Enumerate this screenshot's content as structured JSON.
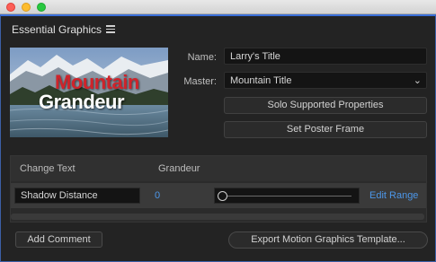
{
  "panel": {
    "title": "Essential Graphics",
    "menu_icon": "hamburger-menu-icon"
  },
  "preview": {
    "title_line1": "Mountain",
    "title_line2": "Grandeur"
  },
  "properties": {
    "name_label": "Name:",
    "name_value": "Larry's Title",
    "master_label": "Master:",
    "master_value": "Mountain Title",
    "solo_button": "Solo Supported Properties",
    "poster_button": "Set Poster Frame"
  },
  "section": {
    "header_left": "Change Text",
    "header_value": "Grandeur",
    "row": {
      "property": "Shadow Distance",
      "value": "0",
      "slider_fraction": 0.0,
      "edit_range": "Edit Range"
    }
  },
  "footer": {
    "add_comment": "Add Comment",
    "export": "Export Motion Graphics Template..."
  },
  "colors": {
    "accent_blue": "#4c96e8",
    "panel_border": "#3a6fd8",
    "title_red": "#d0232a"
  }
}
